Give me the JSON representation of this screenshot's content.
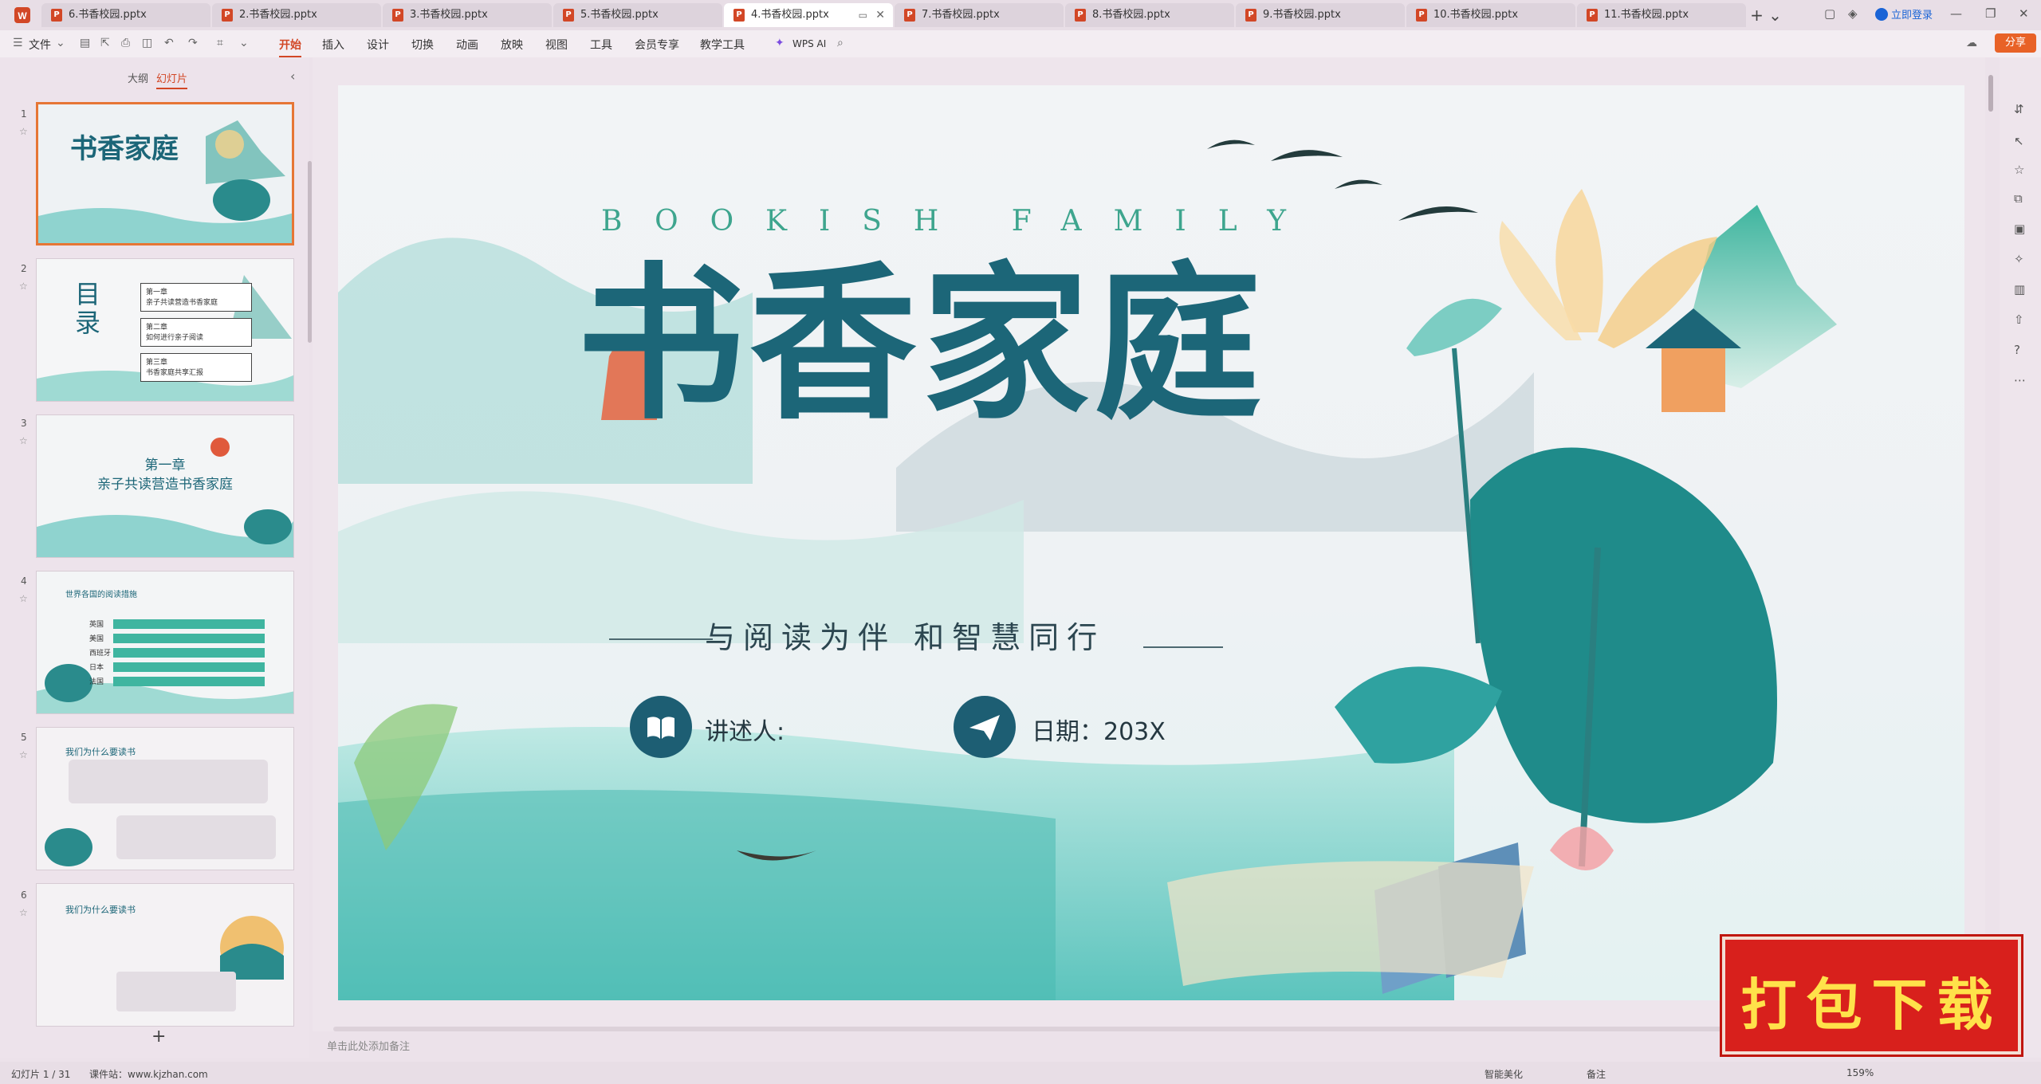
{
  "tabs": [
    {
      "label": "6.书香校园.pptx"
    },
    {
      "label": "2.书香校园.pptx"
    },
    {
      "label": "3.书香校园.pptx"
    },
    {
      "label": "5.书香校园.pptx"
    },
    {
      "label": "4.书香校园.pptx",
      "active": true
    },
    {
      "label": "7.书香校园.pptx"
    },
    {
      "label": "8.书香校园.pptx"
    },
    {
      "label": "9.书香校园.pptx"
    },
    {
      "label": "10.书香校园.pptx"
    },
    {
      "label": "11.书香校园.pptx"
    }
  ],
  "titlebar": {
    "login_label": "立即登录",
    "share_label": "分享"
  },
  "ribbon": {
    "file_label": "文件",
    "menu": [
      "开始",
      "插入",
      "设计",
      "切换",
      "动画",
      "放映",
      "视图",
      "工具",
      "会员专享",
      "教学工具"
    ],
    "ai_label": "WPS AI"
  },
  "panel": {
    "outline_label": "大纲",
    "slides_label": "幻灯片"
  },
  "thumbs": [
    {
      "num": "1",
      "title": "书香家庭"
    },
    {
      "num": "2",
      "title": "目录",
      "items": [
        "第一章",
        "亲子共读营造书香家庭",
        "第二章",
        "如何进行亲子阅读",
        "第三章",
        "书香家庭共享汇报"
      ]
    },
    {
      "num": "3",
      "heading": "第一章",
      "title": "亲子共读营造书香家庭"
    },
    {
      "num": "4",
      "title": "世界各国的阅读措施",
      "rows": [
        "英国",
        "美国",
        "西班牙",
        "日本",
        "法国"
      ]
    },
    {
      "num": "5",
      "title": "我们为什么要读书"
    },
    {
      "num": "6",
      "title": "我们为什么要读书"
    }
  ],
  "slide": {
    "subtitle_en": "BOOKISH FAMILY",
    "title": "书香家庭",
    "tagline": "与阅读为伴 和智慧同行",
    "speaker_label": "讲述人:",
    "date_label": "日期：203X"
  },
  "notes_placeholder": "单击此处添加备注",
  "status": {
    "slide_count": "幻灯片 1 / 31",
    "watermark": "课件站：www.kjzhan.com",
    "smart_beautify": "智能美化",
    "notes_label": "备注",
    "zoom": "159%"
  },
  "download_badge": "打包下载",
  "colors": {
    "accent": "#d24726",
    "title_teal": "#1c6678",
    "badge_red": "#d8201c",
    "badge_text": "#ffe24a"
  }
}
